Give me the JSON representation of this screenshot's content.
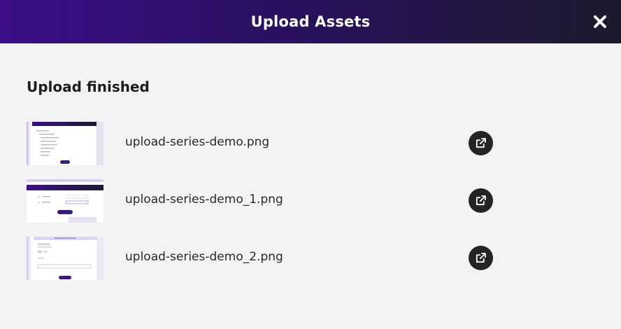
{
  "dialog": {
    "title": "Upload Assets",
    "close_icon": "close-icon"
  },
  "status": {
    "title": "Upload finished"
  },
  "files": [
    {
      "name": "upload-series-demo.png",
      "action_icon": "external-link-icon"
    },
    {
      "name": "upload-series-demo_1.png",
      "action_icon": "external-link-icon"
    },
    {
      "name": "upload-series-demo_2.png",
      "action_icon": "external-link-icon"
    }
  ],
  "colors": {
    "header_start": "#3a0f88",
    "header_end": "#1c1a2c",
    "background": "#f3f3f6",
    "button": "#242424"
  }
}
